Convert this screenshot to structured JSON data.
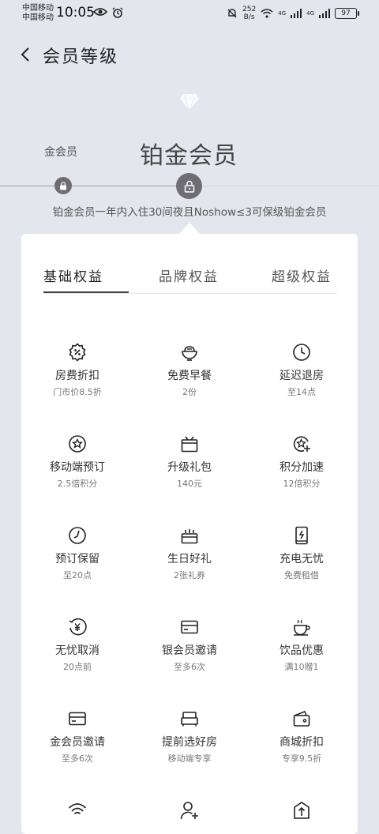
{
  "status": {
    "carrier1": "中国移动",
    "carrier2": "中国移动",
    "time": "10:05",
    "speed_value": "252",
    "speed_unit": "B/s",
    "battery": "97",
    "network1": "4G",
    "network2": "4G"
  },
  "header": {
    "title": "会员等级"
  },
  "level": {
    "prev": "金会员",
    "current": "铂金会员",
    "description": "铂金会员一年内入住30间夜且Noshow≤3可保级铂金会员"
  },
  "tabs": [
    "基础权益",
    "品牌权益",
    "超级权益"
  ],
  "benefits": [
    {
      "icon": "discount-icon",
      "title": "房费折扣",
      "sub": "门市价8.5折"
    },
    {
      "icon": "breakfast-bowl-icon",
      "title": "免费早餐",
      "sub": "2份"
    },
    {
      "icon": "clock-icon",
      "title": "延迟退房",
      "sub": "至14点"
    },
    {
      "icon": "mobile-star-icon",
      "title": "移动端预订",
      "sub": "2.5倍积分"
    },
    {
      "icon": "gift-box-icon",
      "title": "升级礼包",
      "sub": "140元"
    },
    {
      "icon": "points-boost-icon",
      "title": "积分加速",
      "sub": "12倍积分"
    },
    {
      "icon": "reserve-clock-icon",
      "title": "预订保留",
      "sub": "至20点"
    },
    {
      "icon": "birthday-cake-icon",
      "title": "生日好礼",
      "sub": "2张礼券"
    },
    {
      "icon": "power-bank-icon",
      "title": "充电无忧",
      "sub": "免费租借"
    },
    {
      "icon": "refund-icon",
      "title": "无忧取消",
      "sub": "20点前"
    },
    {
      "icon": "silver-card-icon",
      "title": "银会员邀请",
      "sub": "至多6次"
    },
    {
      "icon": "coffee-cup-icon",
      "title": "饮品优惠",
      "sub": "满10赠1"
    },
    {
      "icon": "gold-card-icon",
      "title": "金会员邀请",
      "sub": "至多6次"
    },
    {
      "icon": "bed-icon",
      "title": "提前选好房",
      "sub": "移动端专享"
    },
    {
      "icon": "wallet-icon",
      "title": "商城折扣",
      "sub": "专享9.5折"
    },
    {
      "icon": "wifi-icon",
      "title": "",
      "sub": ""
    },
    {
      "icon": "add-user-icon",
      "title": "",
      "sub": ""
    },
    {
      "icon": "upgrade-icon",
      "title": "",
      "sub": ""
    }
  ]
}
